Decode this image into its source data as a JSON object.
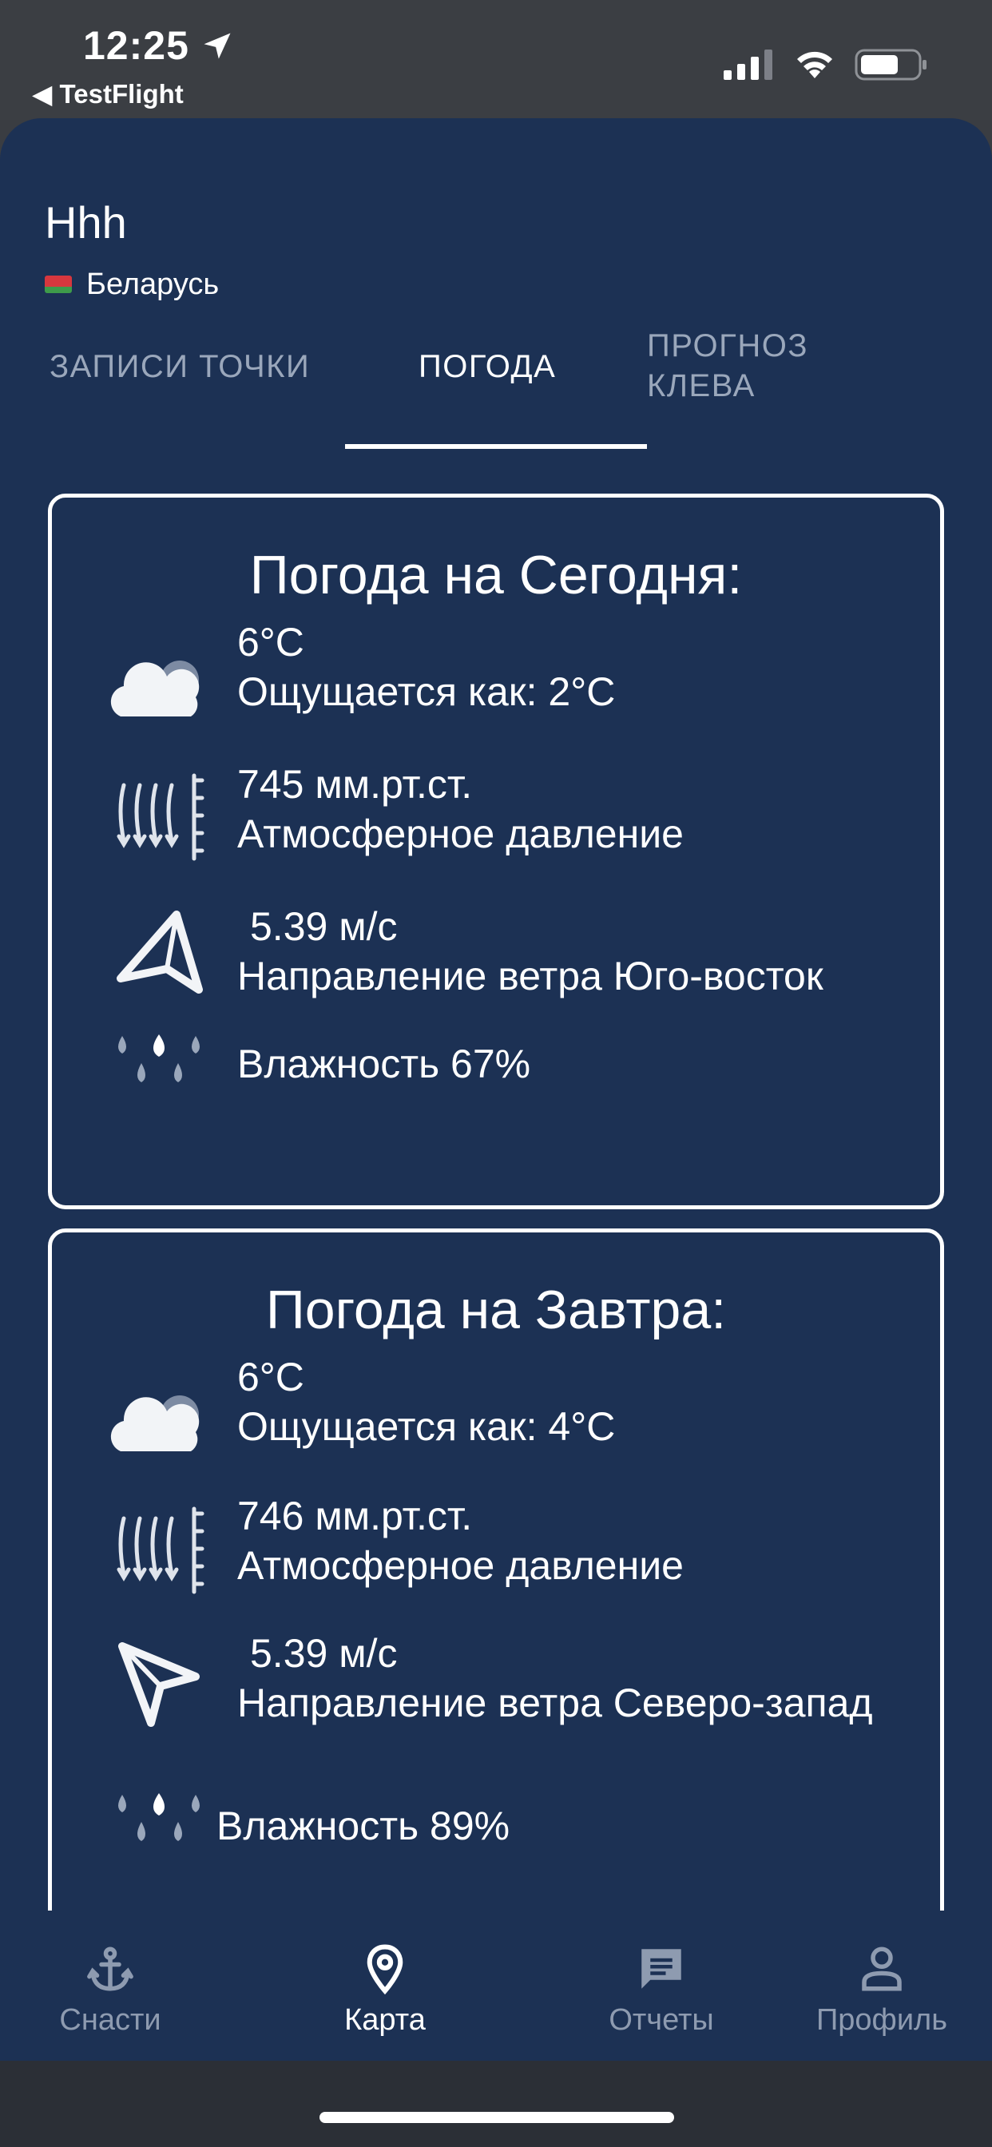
{
  "status_bar": {
    "time": "12:25",
    "back_app": "◀ TestFlight"
  },
  "place": {
    "name": "Hhh",
    "country": "Беларусь"
  },
  "tabs": [
    {
      "label": "ЗАПИСИ ТОЧКИ",
      "active": false
    },
    {
      "label": "ПОГОДА",
      "active": true
    },
    {
      "label_line1": "ПРОГНОЗ",
      "label_line2": "КЛЕВА",
      "active": false
    }
  ],
  "today": {
    "title": "Погода на Сегодня:",
    "temp": "6°C",
    "feels": "Ощущается как: 2°C",
    "pressure_value": "745 мм.рт.ст.",
    "pressure_label": "Атмосферное давление",
    "wind_speed": "5.39 м/с",
    "wind_direction": "Направление ветра Юго-восток",
    "humidity": "Влажность  67%"
  },
  "tomorrow": {
    "title": "Погода на Завтра:",
    "temp": "6°C",
    "feels": "Ощущается как: 4°C",
    "pressure_value": "746 мм.рт.ст.",
    "pressure_label": "Атмосферное давление",
    "wind_speed": "5.39 м/с",
    "wind_direction": "Направление ветра Северо-запад",
    "humidity": "Влажность  89%"
  },
  "nav": [
    {
      "label": "Снасти",
      "icon": "anchor-icon",
      "active": false
    },
    {
      "label": "Карта",
      "icon": "map-pin-icon",
      "active": true
    },
    {
      "label": "Отчеты",
      "icon": "chat-icon",
      "active": false
    },
    {
      "label": "Профиль",
      "icon": "person-icon",
      "active": false
    }
  ],
  "colors": {
    "background": "#1c3154",
    "status_bar": "#3b3e43",
    "inactive": "#8e9bb0",
    "accent": "#ffffff"
  }
}
